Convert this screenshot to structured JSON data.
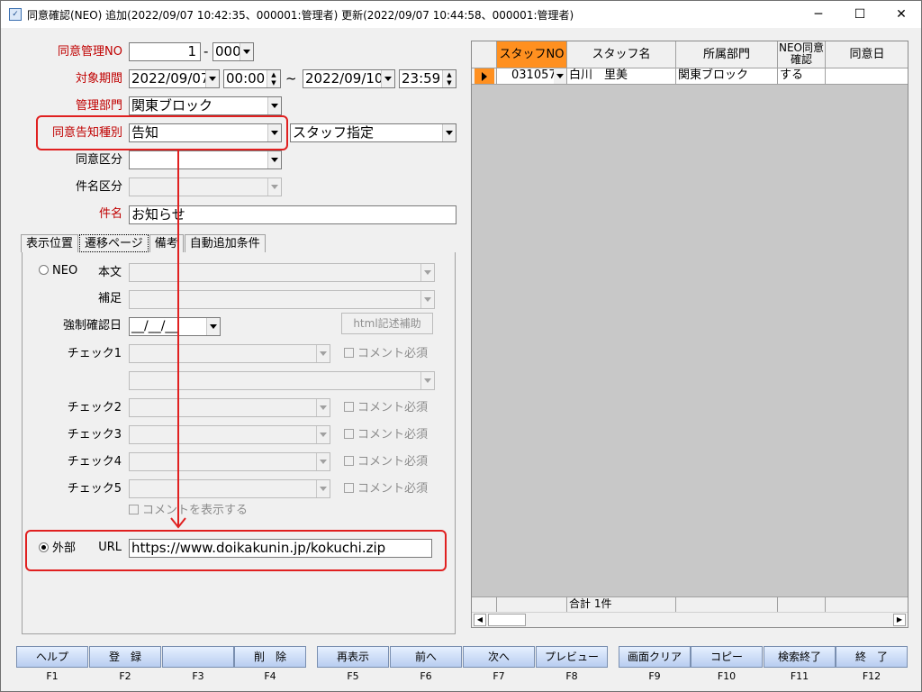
{
  "window": {
    "title": "同意確認(NEO) 追加(2022/09/07 10:42:35、000001:管理者) 更新(2022/09/07 10:44:58、000001:管理者)",
    "minimize": "─",
    "maximize": "☐",
    "close": "✕"
  },
  "form": {
    "mgmt_no_label": "同意管理NO",
    "mgmt_no_value": "1",
    "mgmt_no_dash": "-",
    "mgmt_no_sub": "000",
    "period_label": "対象期間",
    "period_from_date": "2022/09/07",
    "period_from_time": "00:00",
    "period_tilde": "~",
    "period_to_date": "2022/09/10",
    "period_to_time": "23:59",
    "dept_label": "管理部門",
    "dept_value": "関東ブロック",
    "notice_type_label": "同意告知種別",
    "notice_type_value": "告知",
    "staff_spec_value": "スタッフ指定",
    "consent_div_label": "同意区分",
    "consent_div_value": "",
    "subject_div_label": "件名区分",
    "subject_div_value": "",
    "subject_label": "件名",
    "subject_value": "お知らせ"
  },
  "tabs": [
    "表示位置",
    "遷移ページ",
    "備考",
    "自動追加条件"
  ],
  "panel": {
    "neo_radio": "NEO",
    "body_label": "本文",
    "supplement_label": "補足",
    "forced_date_label": "強制確認日",
    "forced_date_value": "__/__/__",
    "html_helper": "html記述補助",
    "check1": "チェック1",
    "check2": "チェック2",
    "check3": "チェック3",
    "check4": "チェック4",
    "check5": "チェック5",
    "comment_required": "コメント必須",
    "show_comment": "コメントを表示する",
    "external_radio": "外部",
    "url_label": "URL",
    "url_value": "https://www.doikakunin.jp/kokuchi.zip"
  },
  "grid": {
    "columns": [
      "スタッフNO",
      "スタッフ名",
      "所属部門",
      "NEO同意確認",
      "同意日"
    ],
    "row": {
      "staff_no": "031057",
      "staff_name": "白川　里美",
      "dept": "関東ブロック",
      "neo_confirm": "する",
      "date": ""
    },
    "footer_total": "合計 1件"
  },
  "fkeys": [
    {
      "label": "ヘルプ",
      "key": "F1"
    },
    {
      "label": "登　録",
      "key": "F2"
    },
    {
      "label": "",
      "key": "F3"
    },
    {
      "label": "削　除",
      "key": "F4"
    },
    {
      "label": "再表示",
      "key": "F5"
    },
    {
      "label": "前へ",
      "key": "F6"
    },
    {
      "label": "次へ",
      "key": "F7"
    },
    {
      "label": "プレビュー",
      "key": "F8"
    },
    {
      "label": "画面クリア",
      "key": "F9"
    },
    {
      "label": "コピー",
      "key": "F10"
    },
    {
      "label": "検索終了",
      "key": "F11"
    },
    {
      "label": "終　了",
      "key": "F12"
    }
  ],
  "colors": {
    "required_label": "#c00000",
    "callout": "#e02020",
    "grid_header_active": "#ff9020",
    "fkey_gradient_top": "#e6f0ff",
    "fkey_gradient_bottom": "#b8cdf0"
  }
}
